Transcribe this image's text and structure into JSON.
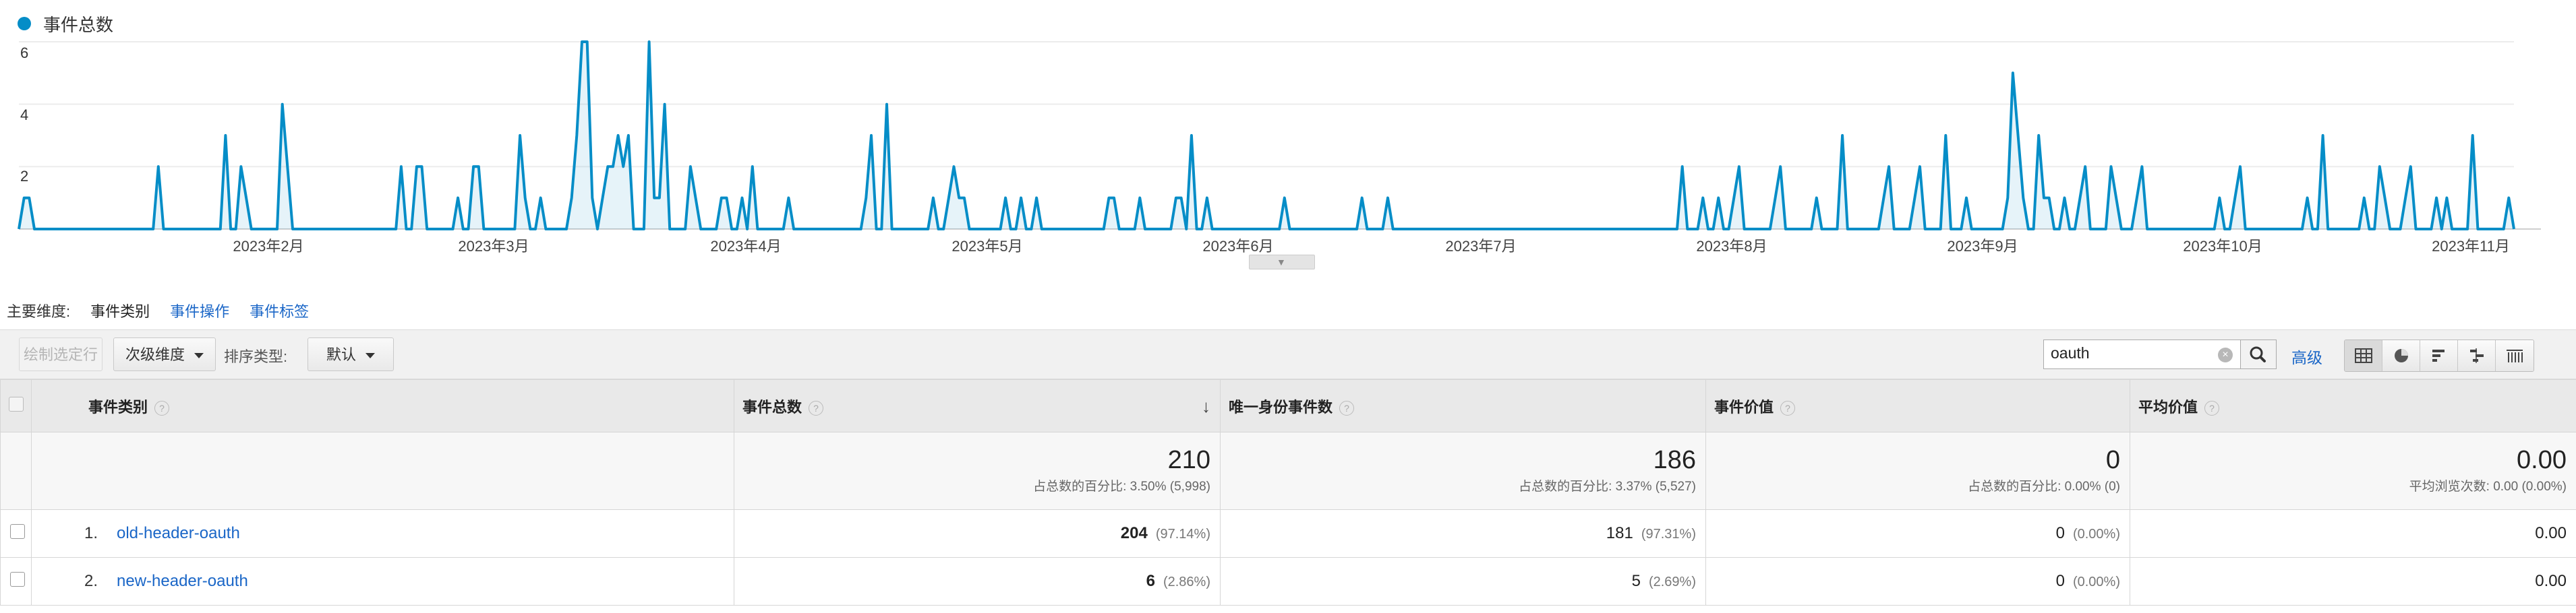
{
  "chart": {
    "legend_label": "事件总数",
    "series_color": "#058dc7",
    "y_ticks": [
      "6",
      "4",
      "2"
    ],
    "x_ticks": [
      "2023年2月",
      "2023年3月",
      "2023年4月",
      "2023年5月",
      "2023年6月",
      "2023年7月",
      "2023年8月",
      "2023年9月",
      "2023年10月",
      "2023年11月"
    ]
  },
  "chart_data": {
    "type": "line",
    "title": "",
    "xlabel": "",
    "ylabel": "",
    "ylim": [
      0,
      6
    ],
    "grid": true,
    "legend": "top-left",
    "series": [
      {
        "name": "事件总数",
        "values": [
          0,
          1,
          1,
          0,
          0,
          0,
          0,
          0,
          0,
          0,
          0,
          0,
          0,
          0,
          0,
          0,
          0,
          0,
          0,
          0,
          0,
          0,
          0,
          0,
          0,
          0,
          0,
          2,
          0,
          0,
          0,
          0,
          0,
          0,
          0,
          0,
          0,
          0,
          0,
          0,
          3,
          0,
          0,
          2,
          1,
          0,
          0,
          0,
          0,
          0,
          0,
          4,
          2,
          0,
          0,
          0,
          0,
          0,
          0,
          0,
          0,
          0,
          0,
          0,
          0,
          0,
          0,
          0,
          0,
          0,
          0,
          0,
          0,
          0,
          2,
          0,
          0,
          2,
          2,
          0,
          0,
          0,
          0,
          0,
          0,
          1,
          0,
          0,
          2,
          2,
          0,
          0,
          0,
          0,
          0,
          0,
          0,
          3,
          1,
          0,
          0,
          1,
          0,
          0,
          0,
          0,
          0,
          1,
          3,
          6,
          6,
          1,
          0,
          1,
          2,
          2,
          3,
          2,
          3,
          0,
          0,
          0,
          6,
          1,
          1,
          4,
          0,
          0,
          0,
          0,
          2,
          1,
          0,
          0,
          0,
          0,
          1,
          1,
          0,
          0,
          1,
          0,
          2,
          0,
          0,
          0,
          0,
          0,
          0,
          1,
          0,
          0,
          0,
          0,
          0,
          0,
          0,
          0,
          0,
          0,
          0,
          0,
          0,
          0,
          1,
          3,
          0,
          0,
          4,
          0,
          0,
          0,
          0,
          0,
          0,
          0,
          0,
          1,
          0,
          0,
          1,
          2,
          1,
          1,
          0,
          0,
          0,
          0,
          0,
          0,
          0,
          1,
          0,
          0,
          1,
          0,
          0,
          1,
          0,
          0,
          0,
          0,
          0,
          0,
          0,
          0,
          0,
          0,
          0,
          0,
          0,
          1,
          1,
          0,
          0,
          0,
          0,
          1,
          0,
          0,
          0,
          0,
          0,
          0,
          1,
          1,
          0,
          3,
          0,
          0,
          1,
          0,
          0,
          0,
          0,
          0,
          0,
          0,
          0,
          0,
          0,
          0,
          0,
          0,
          0,
          1,
          0,
          0,
          0,
          0,
          0,
          0,
          0,
          0,
          0,
          0,
          0,
          0,
          0,
          0,
          1,
          0,
          0,
          0,
          0,
          1,
          0,
          0,
          0,
          0,
          0,
          0,
          0,
          0,
          0,
          0,
          0,
          0,
          0,
          0,
          0,
          0,
          0,
          0,
          0,
          0,
          0,
          0,
          0,
          0,
          0,
          0,
          0,
          0,
          0,
          0,
          0,
          0,
          0,
          0,
          0,
          0,
          0,
          0,
          0,
          0,
          0,
          0,
          0,
          0,
          0,
          0,
          0,
          0,
          0,
          0,
          0,
          0,
          0,
          0,
          0,
          0,
          2,
          0,
          0,
          0,
          1,
          0,
          0,
          1,
          0,
          0,
          1,
          2,
          0,
          0,
          0,
          0,
          0,
          0,
          1,
          2,
          0,
          0,
          0,
          0,
          0,
          0,
          1,
          0,
          0,
          0,
          0,
          3,
          0,
          0,
          0,
          0,
          0,
          0,
          0,
          1,
          2,
          0,
          0,
          0,
          0,
          1,
          2,
          0,
          0,
          0,
          0,
          3,
          0,
          0,
          0,
          1,
          0,
          0,
          0,
          0,
          0,
          0,
          0,
          1,
          5,
          3,
          1,
          0,
          0,
          3,
          1,
          1,
          0,
          0,
          1,
          0,
          0,
          1,
          2,
          0,
          0,
          0,
          0,
          2,
          1,
          0,
          0,
          0,
          1,
          2,
          0,
          0,
          0,
          0,
          0,
          0,
          0,
          0,
          0,
          0,
          0,
          0,
          0,
          0,
          1,
          0,
          0,
          1,
          2,
          0,
          0,
          0,
          0,
          0,
          0,
          0,
          0,
          0,
          0,
          0,
          0,
          1,
          0,
          0,
          3,
          0,
          0,
          0,
          0,
          0,
          0,
          0,
          1,
          0,
          0,
          2,
          1,
          0,
          0,
          0,
          1,
          2,
          0,
          0,
          0,
          0,
          1,
          0,
          1,
          0,
          0,
          0,
          0,
          3,
          0,
          0,
          0,
          0,
          0,
          0,
          1,
          0
        ]
      }
    ]
  },
  "dimensions": {
    "label": "主要维度:",
    "active": "事件类别",
    "links": [
      "事件操作",
      "事件标签"
    ]
  },
  "toolbar": {
    "plot_rows": "绘制选定行",
    "secondary_dim": "次级维度",
    "sort_label": "排序类型:",
    "sort_value": "默认",
    "search_value": "oauth",
    "advanced": "高级",
    "view_icons": [
      "data-table-icon",
      "pie-chart-icon",
      "performance-bar-icon",
      "comparison-icon",
      "pivot-table-icon"
    ]
  },
  "table": {
    "headers": [
      "事件类别",
      "事件总数",
      "唯一身份事件数",
      "事件价值",
      "平均价值"
    ],
    "totals": [
      {
        "value": "210",
        "sub": "占总数的百分比: 3.50% (5,998)"
      },
      {
        "value": "186",
        "sub": "占总数的百分比: 3.37% (5,527)"
      },
      {
        "value": "0",
        "sub": "占总数的百分比: 0.00% (0)"
      },
      {
        "value": "0.00",
        "sub": "平均浏览次数: 0.00 (0.00%)"
      }
    ],
    "rows": [
      {
        "rank": "1.",
        "name": "old-header-oauth",
        "total": "204",
        "total_pct": "(97.14%)",
        "unique": "181",
        "unique_pct": "(97.31%)",
        "value": "0",
        "value_pct": "(0.00%)",
        "avg": "0.00"
      },
      {
        "rank": "2.",
        "name": "new-header-oauth",
        "total": "6",
        "total_pct": "(2.86%)",
        "unique": "5",
        "unique_pct": "(2.69%)",
        "value": "0",
        "value_pct": "(0.00%)",
        "avg": "0.00"
      }
    ]
  }
}
